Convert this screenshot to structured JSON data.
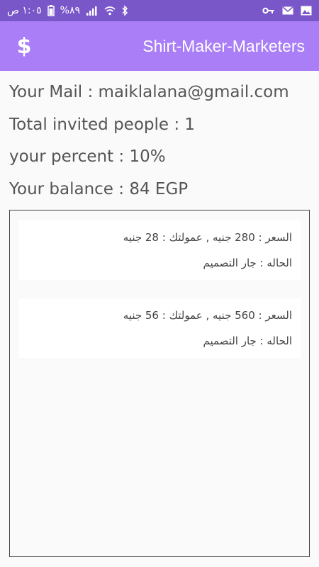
{
  "status_bar": {
    "time": "١:٠٥ ص",
    "battery": "%٨٩",
    "icons": [
      "battery-icon",
      "signal-icon",
      "wifi-icon",
      "bluetooth-icon",
      "key-icon",
      "mail-icon",
      "image-icon"
    ]
  },
  "app_bar": {
    "title": "Shirt-Maker-Marketers",
    "dollar_glyph": "$"
  },
  "info": {
    "mail": "Your Mail : maiklalana@gmail.com",
    "invited": "Total invited people : 1",
    "percent": "your percent : 10%",
    "balance": "Your balance : 84 EGP"
  },
  "orders": [
    {
      "price_line": "السعر : 280 جنيه , عمولتك : 28 جنيه",
      "status_line": "الحاله : جار التصميم"
    },
    {
      "price_line": "السعر : 560 جنيه , عمولتك : 56 جنيه",
      "status_line": "الحاله : جار التصميم"
    }
  ],
  "colors": {
    "status_bar": "#7a57c9",
    "app_bar": "#a97ef7",
    "background": "#fafafa"
  }
}
